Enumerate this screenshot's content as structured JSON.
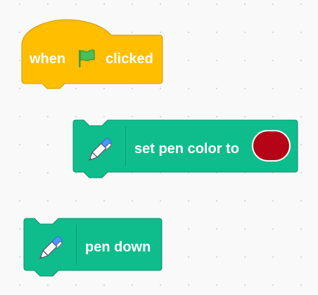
{
  "workspace": {
    "background_color": "#f9f9f9",
    "dot_color": "#d6d6d6"
  },
  "blocks": {
    "hat": {
      "text_when": "when",
      "icon": "green-flag-icon",
      "text_clicked": "clicked",
      "fill": "#ffbf00",
      "stroke": "#cc9900"
    },
    "set_pen_color": {
      "icon": "pen-icon",
      "label": "set pen color to",
      "color_value": "#b40416",
      "fill": "#0fbd8c",
      "stroke": "#0b8e69"
    },
    "pen_down": {
      "icon": "pen-icon",
      "label": "pen down",
      "fill": "#0fbd8c",
      "stroke": "#0b8e69"
    }
  }
}
